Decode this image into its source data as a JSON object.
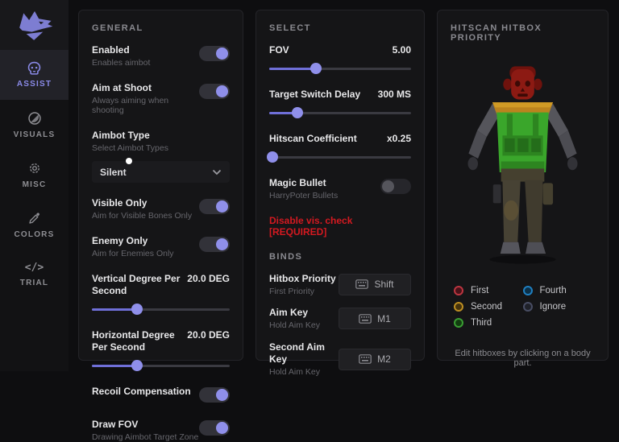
{
  "colors": {
    "accent": "#8f8fea",
    "warning_red": "#d41920",
    "panel_bg": "#151517"
  },
  "sidebar": {
    "items": [
      {
        "label": "ASSIST",
        "icon": "skull-icon"
      },
      {
        "label": "VISUALS",
        "icon": "contrast-icon"
      },
      {
        "label": "MISC",
        "icon": "gear-icon"
      },
      {
        "label": "COLORS",
        "icon": "eyedropper-icon"
      },
      {
        "label": "TRIAL",
        "icon": "code-icon",
        "glyph": "</>"
      }
    ],
    "active_item": "ASSIST"
  },
  "general": {
    "title": "GENERAL",
    "enabled": {
      "label": "Enabled",
      "sub": "Enables aimbot",
      "on": true
    },
    "aim_at_shoot": {
      "label": "Aim at Shoot",
      "sub": "Always aiming when shooting",
      "on": true
    },
    "aimbot_type": {
      "label": "Aimbot Type",
      "sub": "Select Aimbot Types",
      "value": "Silent"
    },
    "visible_only": {
      "label": "Visible Only",
      "sub": "Aim for Visible Bones Only",
      "on": true
    },
    "enemy_only": {
      "label": "Enemy Only",
      "sub": "Aim for Enemies Only",
      "on": true
    },
    "vertical_dps": {
      "label": "Vertical Degree Per Second",
      "value": "20.0 DEG",
      "percent": 33
    },
    "horizontal_dps": {
      "label": "Horizontal Degree Per Second",
      "value": "20.0 DEG",
      "percent": 33
    },
    "recoil": {
      "label": "Recoil Compensation",
      "on": true
    },
    "draw_fov": {
      "label": "Draw FOV",
      "sub": "Drawing Aimbot Target Zone",
      "on": true
    }
  },
  "select": {
    "title": "SELECT",
    "fov": {
      "label": "FOV",
      "value": "5.00",
      "percent": 33
    },
    "target_switch_delay": {
      "label": "Target Switch Delay",
      "value": "300 MS",
      "percent": 20
    },
    "hitscan_coefficient": {
      "label": "Hitscan Coefficient",
      "value": "x0.25",
      "percent": 2
    },
    "magic_bullet": {
      "label": "Magic Bullet",
      "sub": "HarryPoter Bullets",
      "on": false
    },
    "warning": "Disable vis. check [REQUIRED]",
    "binds_title": "BINDS",
    "binds": [
      {
        "label": "Hitbox Priority",
        "sub": "First Priority",
        "key": "Shift"
      },
      {
        "label": "Aim Key",
        "sub": "Hold Aim Key",
        "key": "M1"
      },
      {
        "label": "Second Aim Key",
        "sub": "Hold Aim Key",
        "key": "M2"
      }
    ]
  },
  "hitbox": {
    "title": "HITSCAN HITBOX PRIORITY",
    "legend": [
      {
        "label": "First",
        "ring": "#bc3540",
        "fill": "#481219"
      },
      {
        "label": "Second",
        "ring": "#bd8e22",
        "fill": "#46330c"
      },
      {
        "label": "Third",
        "ring": "#3a9e33",
        "fill": "#123d10"
      },
      {
        "label": "Fourth",
        "ring": "#1f7fc0",
        "fill": "#0c3048"
      },
      {
        "label": "Ignore",
        "ring": "#484d63",
        "fill": "#1f2129"
      }
    ],
    "model": {
      "headgear": "#6e120d",
      "head": "#8c1a13",
      "face_dark": "#3c0a06",
      "shoulders": "#bb831e",
      "shoulders_hi": "#d09a25",
      "torso": "#3aa62b",
      "vest": "#2d8520",
      "pouch": "#246d1a",
      "arm_upper": "#55555b",
      "arm_lower": "#4c4c52",
      "hand": "#323237",
      "hips": "#45402f",
      "leg_l": "#474234",
      "leg_r": "#403b2e",
      "knee": "#5a4f35",
      "gear_dark": "#2e2e32",
      "boot_l": "#55555c",
      "boot_r": "#4e4e55"
    },
    "footnote": "Edit hitboxes by clicking on a body part."
  }
}
